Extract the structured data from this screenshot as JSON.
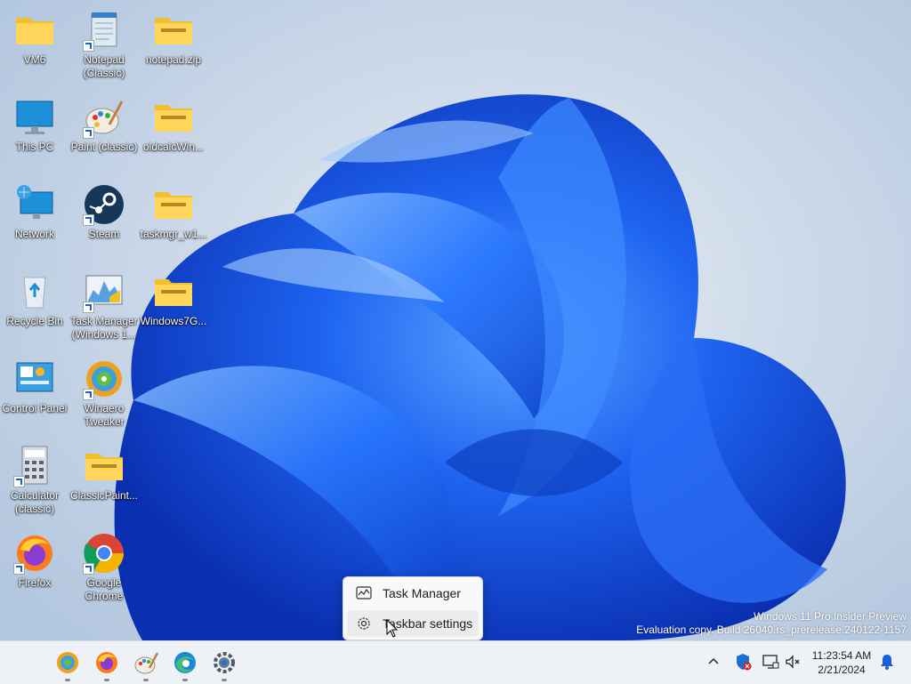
{
  "desktop": {
    "icons": [
      {
        "label": "VM6",
        "icon": "folder-icon"
      },
      {
        "label": "Notepad (Classic)",
        "icon": "notepad-icon"
      },
      {
        "label": "notepad.zip",
        "icon": "zip-folder-icon"
      },
      {
        "label": "This PC",
        "icon": "monitor-icon"
      },
      {
        "label": "Paint (classic)",
        "icon": "paint-palette-icon"
      },
      {
        "label": "oldcalcWin...",
        "icon": "zip-folder-icon"
      },
      {
        "label": "Network",
        "icon": "network-icon"
      },
      {
        "label": "Steam",
        "icon": "steam-icon"
      },
      {
        "label": "taskmgr_w1...",
        "icon": "zip-folder-icon"
      },
      {
        "label": "Recycle Bin",
        "icon": "recycle-bin-icon"
      },
      {
        "label": "Task Manager (Windows 1...",
        "icon": "task-manager-icon"
      },
      {
        "label": "Windows7G...",
        "icon": "zip-folder-icon"
      },
      {
        "label": "Control Panel",
        "icon": "control-panel-icon"
      },
      {
        "label": "Winaero Tweaker",
        "icon": "winaero-icon"
      },
      {
        "label": "Calculator (classic)",
        "icon": "calculator-icon"
      },
      {
        "label": "ClassicPaint...",
        "icon": "zip-folder-icon"
      },
      {
        "label": "Firefox",
        "icon": "firefox-icon"
      },
      {
        "label": "Google Chrome",
        "icon": "chrome-icon"
      }
    ]
  },
  "watermark": {
    "line1": "Windows 11 Pro Insider Preview",
    "line2": "Evaluation copy. Build 26040.rs_prerelease.240122-1157"
  },
  "context_menu": {
    "items": [
      {
        "label": "Task Manager",
        "icon": "task-manager-icon"
      },
      {
        "label": "Taskbar settings",
        "icon": "gear-icon"
      }
    ]
  },
  "taskbar": {
    "apps": [
      {
        "name": "Winaero Tweaker",
        "icon": "winaero-icon"
      },
      {
        "name": "Firefox",
        "icon": "firefox-icon"
      },
      {
        "name": "Paint (classic)",
        "icon": "paint-palette-icon"
      },
      {
        "name": "Microsoft Edge",
        "icon": "edge-icon"
      },
      {
        "name": "Settings",
        "icon": "gear-icon"
      }
    ],
    "clock": {
      "time": "11:23:54 AM",
      "date": "2/21/2024"
    }
  },
  "colors": {
    "wallpaper_blue": "#1a5fe8",
    "accent": "#0067c0",
    "taskbar_bg": "#eef2f7"
  }
}
